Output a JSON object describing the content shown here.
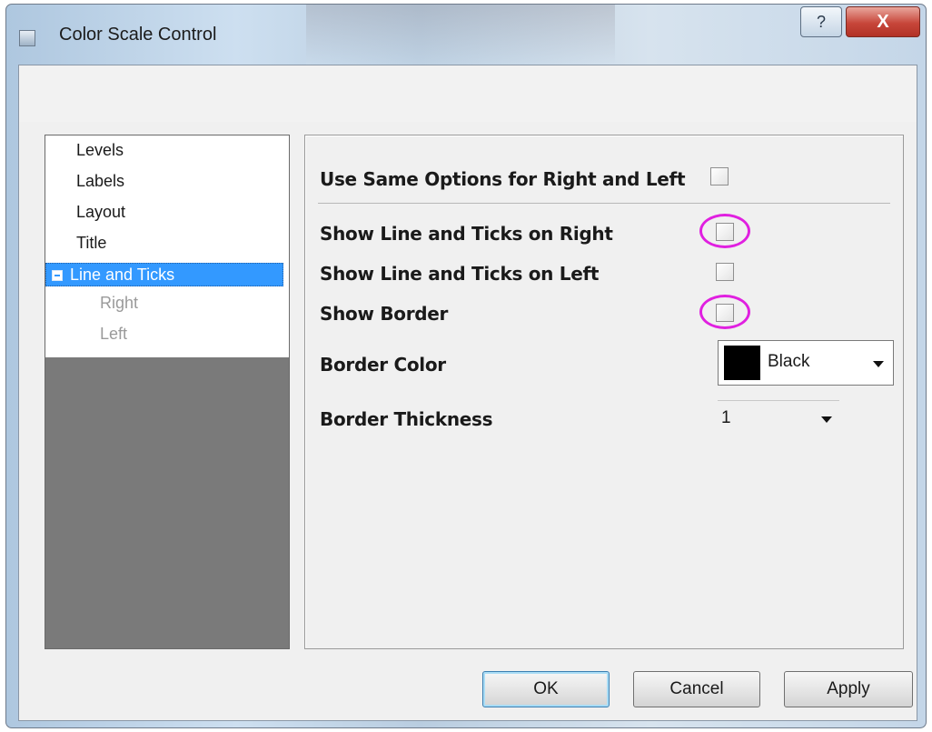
{
  "window": {
    "title": "Color Scale Control",
    "help_label": "?",
    "close_label": "X"
  },
  "tree": {
    "items": [
      "Levels",
      "Labels",
      "Layout",
      "Title"
    ],
    "selected": "Line and Ticks",
    "children": [
      "Right",
      "Left"
    ]
  },
  "options": {
    "same_options_label": "Use Same Options for Right and Left",
    "show_right_label": "Show Line and Ticks on Right",
    "show_left_label": "Show Line and Ticks on Left",
    "show_border_label": "Show Border",
    "border_color_label": "Border Color",
    "border_color_value": "Black",
    "border_thickness_label": "Border Thickness",
    "border_thickness_value": "1",
    "checkboxes": {
      "same_options": false,
      "show_right": false,
      "show_left": false,
      "show_border": false
    }
  },
  "buttons": {
    "ok": "OK",
    "cancel": "Cancel",
    "apply": "Apply"
  },
  "colors": {
    "selection": "#3399ff",
    "highlight_ring": "#e020e0",
    "border_color_swatch": "#000000"
  },
  "icons": {
    "tree_expander": "minus-box-icon",
    "dropdown": "triangle-down-icon"
  }
}
